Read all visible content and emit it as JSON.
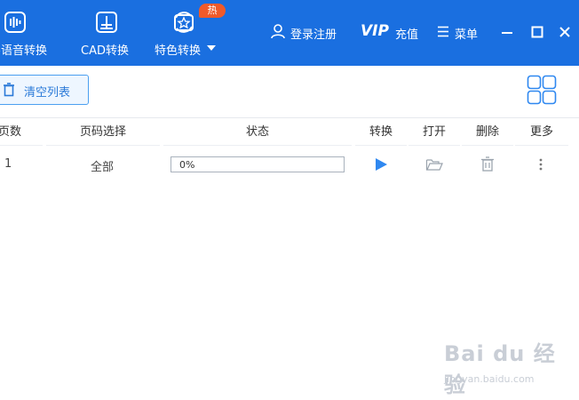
{
  "nav": {
    "items": [
      {
        "label": "字语音转换",
        "icon": "audio-wave-icon"
      },
      {
        "label": "CAD转换",
        "icon": "cad-icon"
      },
      {
        "label": "特色转换",
        "icon": "star-cycle-icon",
        "badge": "热"
      }
    ],
    "login_label": "登录注册",
    "vip_brand": "VIP",
    "vip_label": "充值",
    "menu_label": "菜单"
  },
  "toolbar": {
    "clear_label": "清空列表"
  },
  "table": {
    "headers": [
      "页数",
      "页码选择",
      "状态",
      "转换",
      "打开",
      "删除",
      "更多"
    ],
    "rows": [
      {
        "pages": "1",
        "page_select": "全部",
        "progress_text": "0%",
        "progress": 0
      }
    ]
  },
  "watermark": {
    "brand": "Bai du 经验",
    "url": "jingyan.baidu.com"
  },
  "colors": {
    "topbar": "#1a6fe0",
    "accent": "#2f88f0",
    "badge": "#f05a2a"
  }
}
